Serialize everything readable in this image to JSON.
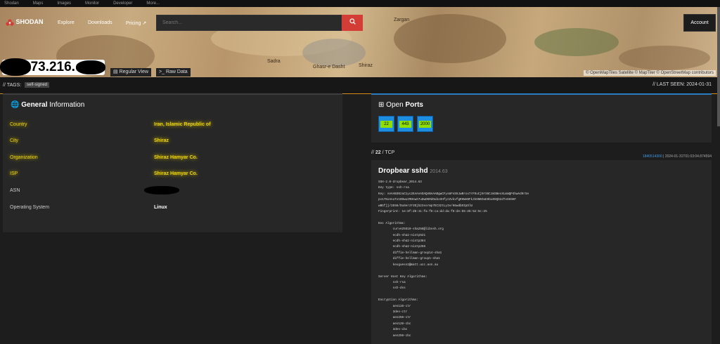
{
  "topbar": [
    "Shodan",
    "Maps",
    "Images",
    "Monitor",
    "Developer",
    "More..."
  ],
  "nav": {
    "logo": "SHODAN",
    "links": [
      "Explore",
      "Downloads",
      "Pricing ↗"
    ],
    "search_placeholder": "Search...",
    "account": "Account"
  },
  "hero": {
    "ip_visible": "173.216.",
    "regular_view": "Regular View",
    "raw_data": "Raw Data",
    "map_attribution": "© OpenMapTiles Satellite  © MapTiler  © OpenStreetMap contributors",
    "city_labels": [
      "Shiraz",
      "Zargan",
      "Sadra",
      "Ghasr-e Dasht"
    ]
  },
  "tags": {
    "label": "// TAGS:",
    "items": [
      "self-signed"
    ]
  },
  "last_seen": "// LAST SEEN: 2024-01-31",
  "general": {
    "title_bold": "General",
    "title_rest": " Information",
    "rows": [
      {
        "k": "Country",
        "v": "Iran, Islamic Republic of",
        "hl": true
      },
      {
        "k": "City",
        "v": "Shiraz",
        "hl": true
      },
      {
        "k": "Organization",
        "v": "Shiraz Hamyar Co.",
        "hl": true
      },
      {
        "k": "ISP",
        "v": "Shiraz Hamyar Co.",
        "hl": true
      },
      {
        "k": "ASN",
        "v": "",
        "hl": false
      },
      {
        "k": "Operating System",
        "v": "Linux",
        "hl": false
      }
    ]
  },
  "ports": {
    "title_rest": "Open ",
    "title_bold": "Ports",
    "list": [
      "22",
      "443",
      "2000"
    ]
  },
  "service": {
    "header_port": "22",
    "header_proto": " / TCP",
    "hash_link": "1840514300",
    "timestamp": "2024-01-31T01:03:04.874594",
    "title": "Dropbear sshd",
    "version": "2014.63",
    "banner": "SSH-2.0-dropbear_2014.63\nKey type: ssh-rsa\nKey: AAAAB3NzaC1yc2EAAAADAQABAAABgwCFysmFnS5JwBrox7rFOuCj9rS6CJmSBesXLmmQP4hwAd9rSe\npv17KoAnuTvnOOwuIMHnwX7uDwOKRdOubsXHfyzZvkvfgRHWeBFkJk6NKOuEHbuOSQS2dTv6HSKF\nwBGfjj/2E66/DuSerzF3Djb23ssrmp7EC32tLyIe/H6wdbOIpOlU\nFingerprint: 1e:8f:d8:11:fa:f8:ca:dd:da:f8:de:55:25:52:5c:25\n\nKex Algorithms:\n\tcurve25519-sha256@libssh.org\n\tecdh-sha2-nistp521\n\tecdh-sha2-nistp384\n\tecdh-sha2-nistp256\n\tdiffie-hellman-group14-sha1\n\tdiffie-hellman-group1-sha1\n\tkexguess2@matt.ucc.asn.au\n\nServer Host Key Algorithms:\n\tssh-rsa\n\tssh-dss\n\nEncryption Algorithms:\n\taes128-ctr\n\t3des-ctr\n\taes256-ctr\n\taes128-cbc\n\t3des-cbc\n\taes256-cbc"
  },
  "colors": {
    "accent": "#d43d36",
    "highlight": "#f0d600",
    "port_blue": "#1e8fe0",
    "port_green": "#8fe000",
    "link": "#3d9be9"
  }
}
